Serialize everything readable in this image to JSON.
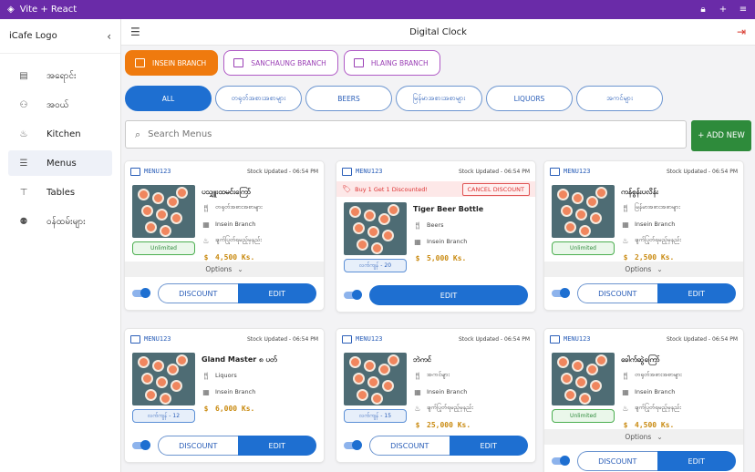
{
  "window": {
    "title": "Vite + React"
  },
  "sidebar": {
    "logo": "iCafe Logo",
    "items": [
      {
        "label": "အရောင်း",
        "icon": "register-icon"
      },
      {
        "label": "အဝယ်",
        "icon": "basket-icon"
      },
      {
        "label": "Kitchen",
        "icon": "kitchen-icon"
      },
      {
        "label": "Menus",
        "icon": "menus-icon",
        "active": true
      },
      {
        "label": "Tables",
        "icon": "table-icon"
      },
      {
        "label": "ဝန်ထမ်းများ",
        "icon": "people-icon"
      }
    ]
  },
  "header": {
    "title": "Digital Clock"
  },
  "branches": [
    {
      "label": "INSEIN BRANCH",
      "active": true
    },
    {
      "label": "SANCHAUNG BRANCH"
    },
    {
      "label": "HLAING BRANCH"
    }
  ],
  "categories": [
    {
      "label": "ALL",
      "active": true
    },
    {
      "label": "တရုတ်အစားအစာများ"
    },
    {
      "label": "BEERS"
    },
    {
      "label": "မြန်မာအစားအစာများ"
    },
    {
      "label": "LIQUORS"
    },
    {
      "label": "အကင်များ"
    }
  ],
  "search": {
    "placeholder": "Search Menus",
    "value": ""
  },
  "add_new_label": "+ ADD NEW",
  "labels": {
    "options": "Options",
    "discount": "DISCOUNT",
    "edit": "EDIT",
    "cancel_discount": "CANCEL DISCOUNT"
  },
  "colors": {
    "accent": "#1e6fd1",
    "branch_active": "#ef7a0e",
    "add_new": "#2e8b3b",
    "titlebar": "#6a2ba8",
    "price": "#c98a10"
  },
  "cards": [
    {
      "code": "MENU123",
      "stock": "Stock Updated - 06:54 PM",
      "name": "ပသျှူးထမင်းကြော်",
      "category": "တရုတ်အစားအစာများ",
      "branch": "Insein Branch",
      "kitchen": "ချက်ပြုတ်ရမည့်မှနည်း",
      "price": "4,500 Ks.",
      "chip": "Unlimited",
      "chip_style": "green",
      "options": true,
      "discount_btn": true
    },
    {
      "code": "MENU123",
      "stock": "Stock Updated - 06:54 PM",
      "promo": "Buy 1 Get 1 Discounted!",
      "name": "Tiger Beer Bottle",
      "category": "Beers",
      "branch": "Insein Branch",
      "price": "5,000 Ks.",
      "chip": "လက်ကျန် - 20",
      "chip_style": "blue",
      "options": false,
      "discount_btn": false
    },
    {
      "code": "MENU123",
      "stock": "Stock Updated - 06:54 PM",
      "name": "ကန်စွန်းပလိန်း",
      "category": "မြန်မာအစားအစာများ",
      "branch": "Insein Branch",
      "kitchen": "ချက်ပြုတ်ရမည့်မှနည်း",
      "price": "2,500 Ks.",
      "chip": "Unlimited",
      "chip_style": "green",
      "options": true,
      "discount_btn": true
    },
    {
      "code": "MENU123",
      "stock": "Stock Updated - 06:54 PM",
      "name": "Gland Master ၈ ပတ်",
      "category": "Liquors",
      "branch": "Insein Branch",
      "price": "6,000 Ks.",
      "chip": "လက်ကျန် - 12",
      "chip_style": "blue",
      "options": false,
      "discount_btn": true
    },
    {
      "code": "MENU123",
      "stock": "Stock Updated - 06:54 PM",
      "name": "ဘဲကင်",
      "category": "အကင်များ",
      "branch": "Insein Branch",
      "kitchen": "ချက်ပြုတ်ရမည့်မှနည်း",
      "price": "25,000 Ks.",
      "chip": "လက်ကျန် - 15",
      "chip_style": "blue",
      "options": false,
      "discount_btn": true
    },
    {
      "code": "MENU123",
      "stock": "Stock Updated - 06:54 PM",
      "name": "ခေါက်ဆွဲကြော်",
      "category": "တရုတ်အစားအစာများ",
      "branch": "Insein Branch",
      "kitchen": "ချက်ပြုတ်ရမည့်မှနည်း",
      "price": "4,500 Ks.",
      "chip": "Unlimited",
      "chip_style": "green",
      "options": true,
      "discount_btn": true
    }
  ]
}
